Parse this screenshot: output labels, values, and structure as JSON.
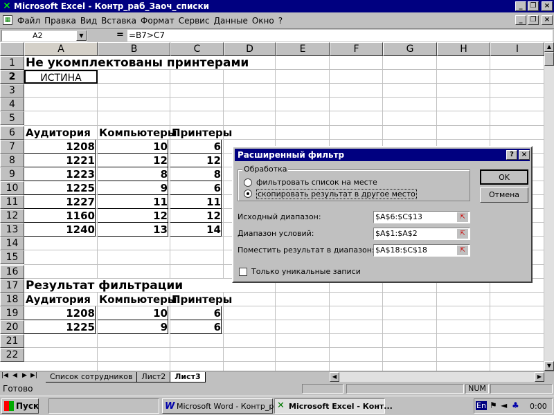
{
  "title_bar": {
    "title": "Microsoft Excel - Контр_раб_Заоч_списки"
  },
  "menu": [
    "Файл",
    "Правка",
    "Вид",
    "Вставка",
    "Формат",
    "Сервис",
    "Данные",
    "Окно",
    "?"
  ],
  "formula_bar": {
    "name_box": "A2",
    "equals": "=",
    "formula": "=B7>C7"
  },
  "columns": [
    "A",
    "B",
    "C",
    "D",
    "E",
    "F",
    "G",
    "H",
    "I"
  ],
  "rows": [
    "1",
    "2",
    "3",
    "4",
    "5",
    "6",
    "7",
    "8",
    "9",
    "10",
    "11",
    "12",
    "13",
    "14",
    "15",
    "16",
    "17",
    "18",
    "19",
    "20",
    "21",
    "22"
  ],
  "cells": {
    "title1": "Не укомплектованы принтерами",
    "a2": "ИСТИНА",
    "h_aud": "Аудитория",
    "h_comp": "Компьютеры",
    "h_print": "Принтеры",
    "title17": "Результат фильтрации",
    "h_aud2": "Аудитория",
    "h_comp2": "Компьютеры",
    "h_print2": "Принтеры"
  },
  "table": [
    [
      "1208",
      "10",
      "6"
    ],
    [
      "1221",
      "12",
      "12"
    ],
    [
      "1223",
      "8",
      "8"
    ],
    [
      "1225",
      "9",
      "6"
    ],
    [
      "1227",
      "11",
      "11"
    ],
    [
      "1160",
      "12",
      "12"
    ],
    [
      "1240",
      "13",
      "14"
    ]
  ],
  "result": [
    [
      "1208",
      "10",
      "6"
    ],
    [
      "1225",
      "9",
      "6"
    ]
  ],
  "sheet_tabs": [
    "Список сотрудников",
    "Лист2",
    "Лист3"
  ],
  "status": {
    "ready": "Готово",
    "num": "NUM"
  },
  "taskbar": {
    "start": "Пуск",
    "word": "Microsoft Word - Контр_р...",
    "excel": "Microsoft Excel - Конт...",
    "lang": "En",
    "clock": "0:00"
  },
  "dialog": {
    "title": "Расширенный фильтр",
    "help": "?",
    "close": "×",
    "group": "Обработка",
    "radio1": "фильтровать список на месте",
    "radio2": "скопировать результат в другое место",
    "radio_selected": "radio2",
    "src_label": "Исходный диапазон:",
    "src_value": "$A$6:$C$13",
    "cond_label": "Диапазон условий:",
    "cond_value": "$A$1:$A$2",
    "dest_label": "Поместить результат в диапазон:",
    "dest_value": "$A$18:$C$18",
    "unique_label": "Только уникальные записи",
    "unique_checked": false,
    "ok": "OK",
    "cancel": "Отмена"
  }
}
